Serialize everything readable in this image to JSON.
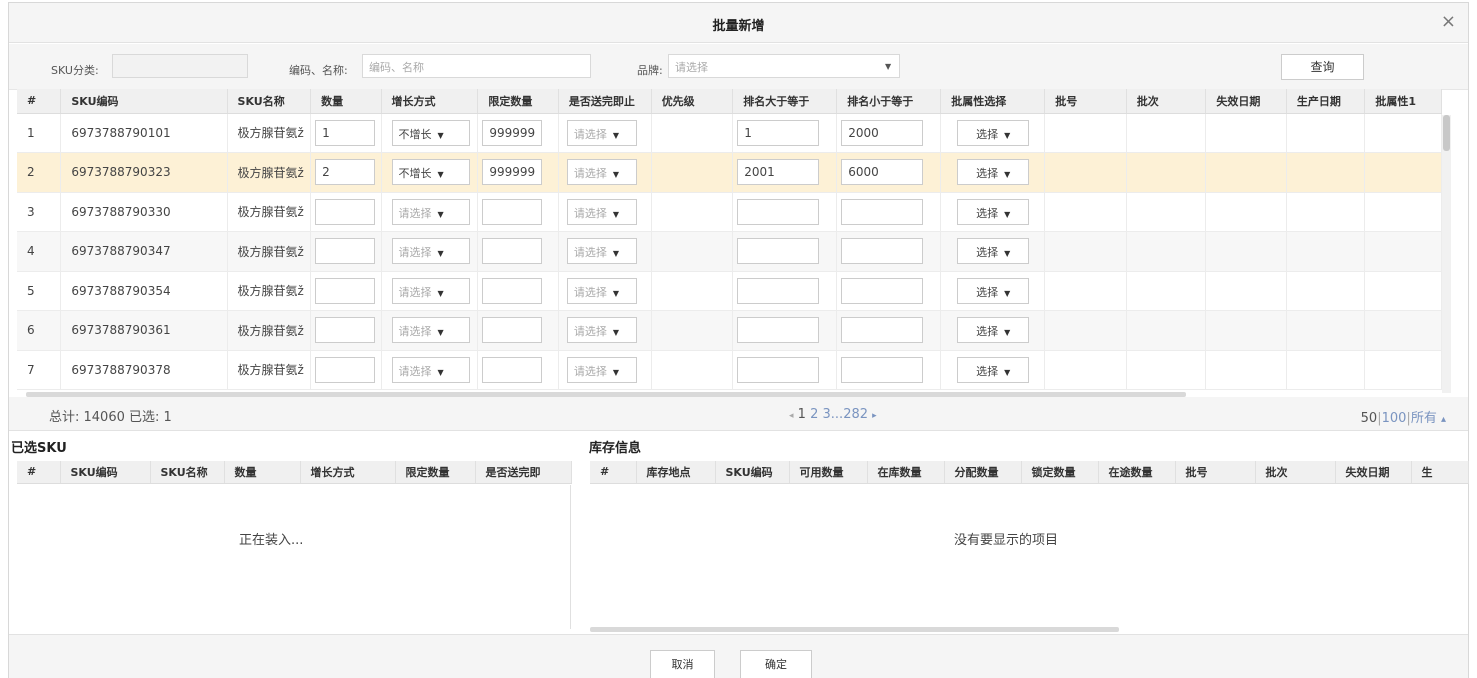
{
  "dialog": {
    "title": "批量新增",
    "close_label": "×"
  },
  "filters": {
    "sku_category_label": "SKU分类:",
    "sku_category_value": "",
    "code_name_label": "编码、名称:",
    "code_name_placeholder": "编码、名称",
    "brand_label": "品牌:",
    "brand_placeholder": "请选择",
    "query_label": "查询"
  },
  "grid": {
    "columns": [
      "#",
      "SKU编码",
      "SKU名称",
      "数量",
      "增长方式",
      "限定数量",
      "是否送完即止",
      "优先级",
      "排名大于等于",
      "排名小于等于",
      "批属性选择",
      "批号",
      "批次",
      "失效日期",
      "生产日期",
      "批属性1"
    ],
    "rows": [
      {
        "no": "1",
        "code": "6973788790101",
        "name": "极方腺苷氨ž",
        "qty": "1",
        "growth": "不增长",
        "limit": "999999",
        "stop": "请选择",
        "rank_gte": "1",
        "rank_lte": "2000",
        "attr": "选择"
      },
      {
        "no": "2",
        "code": "6973788790323",
        "name": "极方腺苷氨ž",
        "qty": "2",
        "growth": "不增长",
        "limit": "999999",
        "stop": "请选择",
        "rank_gte": "2001",
        "rank_lte": "6000",
        "attr": "选择"
      },
      {
        "no": "3",
        "code": "6973788790330",
        "name": "极方腺苷氨ž",
        "qty": "",
        "growth": "请选择",
        "limit": "",
        "stop": "请选择",
        "rank_gte": "",
        "rank_lte": "",
        "attr": "选择"
      },
      {
        "no": "4",
        "code": "6973788790347",
        "name": "极方腺苷氨ž",
        "qty": "",
        "growth": "请选择",
        "limit": "",
        "stop": "请选择",
        "rank_gte": "",
        "rank_lte": "",
        "attr": "选择"
      },
      {
        "no": "5",
        "code": "6973788790354",
        "name": "极方腺苷氨ž",
        "qty": "",
        "growth": "请选择",
        "limit": "",
        "stop": "请选择",
        "rank_gte": "",
        "rank_lte": "",
        "attr": "选择"
      },
      {
        "no": "6",
        "code": "6973788790361",
        "name": "极方腺苷氨ž",
        "qty": "",
        "growth": "请选择",
        "limit": "",
        "stop": "请选择",
        "rank_gte": "",
        "rank_lte": "",
        "attr": "选择"
      },
      {
        "no": "7",
        "code": "6973788790378",
        "name": "极方腺苷氨ž",
        "qty": "",
        "growth": "请选择",
        "limit": "",
        "stop": "请选择",
        "rank_gte": "",
        "rank_lte": "",
        "attr": "选择"
      }
    ],
    "selected_row": "2"
  },
  "pager": {
    "total_text": "总计: 14060 已选: 1",
    "prev": "◂",
    "page1": "1",
    "page2": "2",
    "page3": "3",
    "ellipsis": "...",
    "last": "282",
    "next": "▸",
    "size50": "50",
    "size100": "100",
    "size_all": "所有",
    "size_arrow": "▴"
  },
  "selected_sku": {
    "title": "已选SKU",
    "columns": [
      "#",
      "SKU编码",
      "SKU名称",
      "数量",
      "增长方式",
      "限定数量",
      "是否送完即"
    ],
    "loading": "正在装入..."
  },
  "inventory": {
    "title": "库存信息",
    "columns": [
      "#",
      "库存地点",
      "SKU编码",
      "可用数量",
      "在库数量",
      "分配数量",
      "锁定数量",
      "在途数量",
      "批号",
      "批次",
      "失效日期",
      "生"
    ],
    "empty": "没有要显示的项目"
  },
  "footer": {
    "cancel": "取消",
    "confirm": "确定"
  }
}
